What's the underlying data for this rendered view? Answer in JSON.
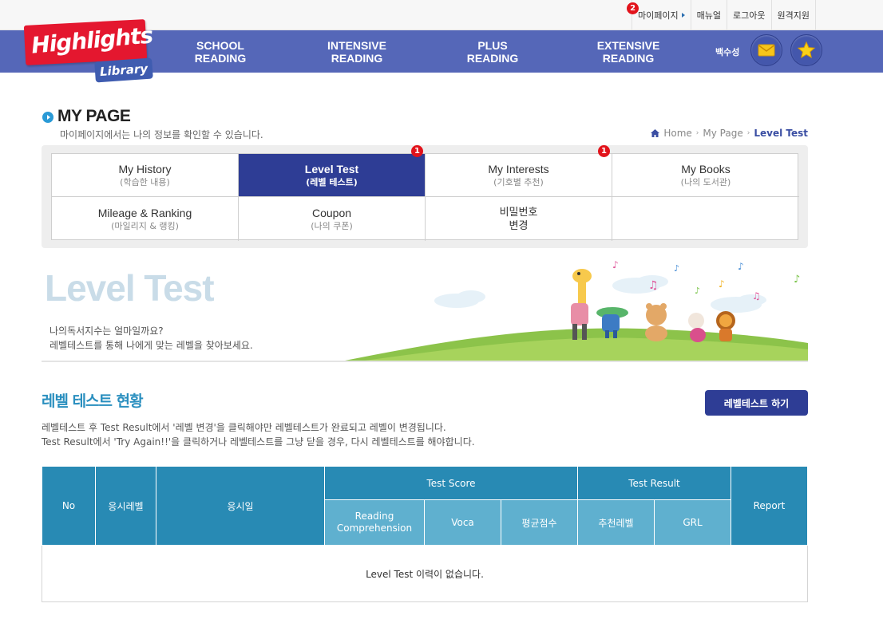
{
  "util": {
    "links": [
      "마이페이지",
      "매뉴얼",
      "로그아웃",
      "원격지원"
    ],
    "mypage_badge": "2"
  },
  "nav": {
    "logo_main": "Highlights",
    "logo_sub": "Library",
    "items": [
      {
        "line1": "SCHOOL",
        "line2": "READING"
      },
      {
        "line1": "INTENSIVE",
        "line2": "READING"
      },
      {
        "line1": "PLUS",
        "line2": "READING"
      },
      {
        "line1": "EXTENSIVE",
        "line2": "READING"
      }
    ],
    "user_name": "백수성",
    "mail_icon": "envelope-icon",
    "star_icon": "star-icon"
  },
  "page": {
    "title": "MY PAGE",
    "subtitle": "마이페이지에서는 나의 정보를 확인할 수 있습니다.",
    "breadcrumb": [
      "Home",
      "My Page",
      "Level Test"
    ]
  },
  "tabs": [
    {
      "label": "My History",
      "sub": "(학습한 내용)",
      "active": false,
      "badge": ""
    },
    {
      "label": "Level Test",
      "sub": "(레벨 테스트)",
      "active": true,
      "badge": "1"
    },
    {
      "label": "My Interests",
      "sub": "(기호별 추천)",
      "active": false,
      "badge": "1"
    },
    {
      "label": "My Books",
      "sub": "(나의 도서관)",
      "active": false,
      "badge": ""
    },
    {
      "label": "Mileage & Ranking",
      "sub": "(마일리지 & 랭킹)",
      "active": false,
      "badge": ""
    },
    {
      "label": "Coupon",
      "sub": "(나의 쿠폰)",
      "active": false,
      "badge": ""
    },
    {
      "label": "비밀번호",
      "sub": "변경",
      "active": false,
      "badge": ""
    },
    {
      "label": "",
      "sub": "",
      "active": false,
      "badge": ""
    }
  ],
  "banner": {
    "title": "Level Test",
    "line1": "나의독서지수는 얼마일까요?",
    "line2": "레벨테스트를 통해 나에게 맞는 레벨을 찾아보세요."
  },
  "section": {
    "title": "레벨 테스트 현황",
    "button": "레벨테스트 하기",
    "note1": "레벨테스트 후 Test Result에서 '레벨 변경'을 클릭해야만 레벨테스트가 완료되고 레벨이 변경됩니다.",
    "note2": "Test Result에서 'Try Again!!'을 클릭하거나 레벨테스트를 그냥 닫을 경우, 다시 레벨테스트를 해야합니다."
  },
  "table": {
    "headers": {
      "no": "No",
      "level": "응시레벨",
      "date": "응시일",
      "score": "Test Score",
      "result": "Test Result",
      "report": "Report",
      "reading": "Reading Comprehension",
      "voca": "Voca",
      "avg": "평균점수",
      "rec_level": "추천레벨",
      "grl": "GRL"
    },
    "empty_message": "Level Test 이력이 없습니다."
  },
  "colors": {
    "nav": "#5567b8",
    "active_tab": "#2e3d95",
    "table_header": "#288ab4",
    "table_subheader": "#5fb0cf",
    "section_title": "#2a8fbf",
    "badge": "#e2131b"
  }
}
